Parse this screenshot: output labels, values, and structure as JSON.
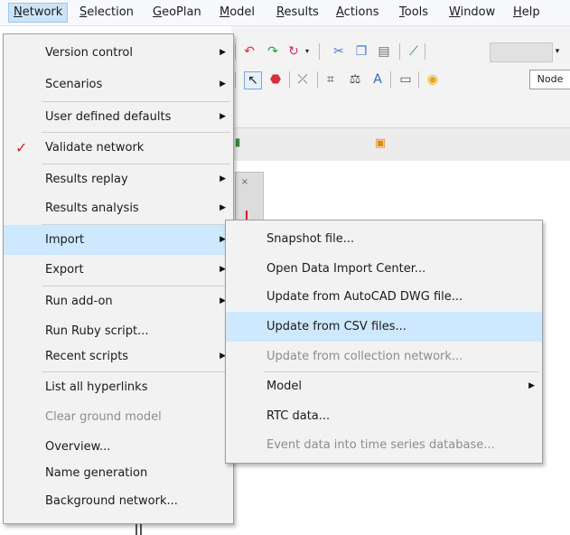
{
  "menubar": {
    "items": [
      {
        "label": "Network",
        "u": "N"
      },
      {
        "label": "Selection",
        "u": "S"
      },
      {
        "label": "GeoPlan",
        "u": "G"
      },
      {
        "label": "Model",
        "u": "M"
      },
      {
        "label": "Results",
        "u": "R"
      },
      {
        "label": "Actions",
        "u": "A"
      },
      {
        "label": "Tools",
        "u": "T"
      },
      {
        "label": "Window",
        "u": "W"
      },
      {
        "label": "Help",
        "u": "H"
      }
    ]
  },
  "toolbar": {
    "node_label": "Node"
  },
  "network_menu": {
    "items": [
      {
        "label": "Version control",
        "has_submenu": true
      },
      {
        "label": "Scenarios",
        "has_submenu": true
      },
      {
        "label": "User defined defaults",
        "has_submenu": true
      },
      {
        "label": "Validate network",
        "checked": true
      },
      {
        "label": "Results replay",
        "has_submenu": true
      },
      {
        "label": "Results analysis",
        "has_submenu": true
      },
      {
        "label": "Import",
        "has_submenu": true,
        "highlighted": true
      },
      {
        "label": "Export",
        "has_submenu": true
      },
      {
        "label": "Run add-on",
        "has_submenu": true
      },
      {
        "label": "Run Ruby script..."
      },
      {
        "label": "Recent scripts",
        "has_submenu": true
      },
      {
        "label": "List all hyperlinks"
      },
      {
        "label": "Clear ground model",
        "disabled": true
      },
      {
        "label": "Overview..."
      },
      {
        "label": "Name generation"
      },
      {
        "label": "Background network..."
      }
    ]
  },
  "import_submenu": {
    "items": [
      {
        "label": "Snapshot file..."
      },
      {
        "label": "Open Data Import Center..."
      },
      {
        "label": "Update from AutoCAD DWG file..."
      },
      {
        "label": "Update from CSV files...",
        "highlighted": true
      },
      {
        "label": "Update from collection network...",
        "disabled": true
      },
      {
        "label": "Model",
        "has_submenu": true
      },
      {
        "label": "RTC data..."
      },
      {
        "label": "Event data into time series database...",
        "disabled": true
      }
    ]
  },
  "colors": {
    "menu_highlight": "#cde8ff",
    "check": "#d11f24",
    "disabled_text": "#8d8d8d"
  }
}
